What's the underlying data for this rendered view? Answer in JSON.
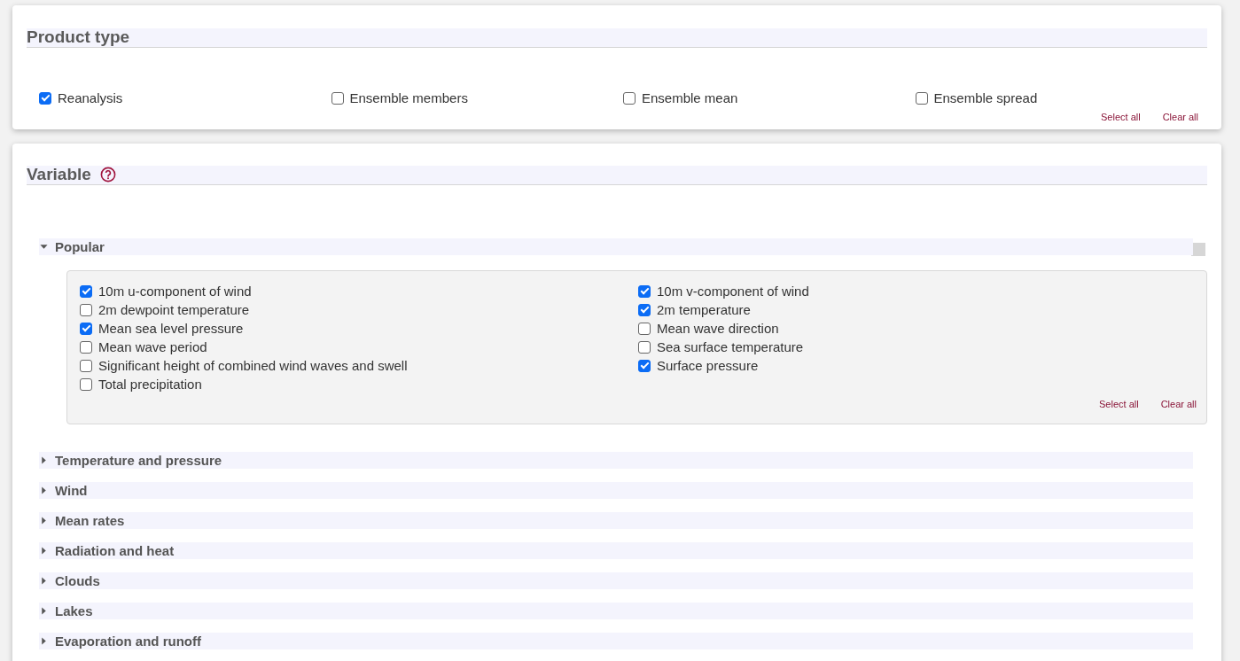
{
  "product_type": {
    "title": "Product type",
    "options": [
      {
        "label": "Reanalysis",
        "checked": true
      },
      {
        "label": "Ensemble members",
        "checked": false
      },
      {
        "label": "Ensemble mean",
        "checked": false
      },
      {
        "label": "Ensemble spread",
        "checked": false
      }
    ],
    "actions": [
      "Select all",
      "Clear all"
    ]
  },
  "variable": {
    "title": "Variable",
    "groups": [
      {
        "label": "Popular",
        "expanded": true,
        "items": [
          {
            "label": "10m u-component of wind",
            "checked": true
          },
          {
            "label": "10m v-component of wind",
            "checked": true
          },
          {
            "label": "2m dewpoint temperature",
            "checked": false
          },
          {
            "label": "2m temperature",
            "checked": true
          },
          {
            "label": "Mean sea level pressure",
            "checked": true
          },
          {
            "label": "Mean wave direction",
            "checked": false
          },
          {
            "label": "Mean wave period",
            "checked": false
          },
          {
            "label": "Sea surface temperature",
            "checked": false
          },
          {
            "label": "Significant height of combined wind waves and swell",
            "checked": false
          },
          {
            "label": "Surface pressure",
            "checked": true
          },
          {
            "label": "Total precipitation",
            "checked": false
          }
        ],
        "actions": [
          "Select all",
          "Clear all"
        ]
      },
      {
        "label": "Temperature and pressure",
        "expanded": false
      },
      {
        "label": "Wind",
        "expanded": false
      },
      {
        "label": "Mean rates",
        "expanded": false
      },
      {
        "label": "Radiation and heat",
        "expanded": false
      },
      {
        "label": "Clouds",
        "expanded": false
      },
      {
        "label": "Lakes",
        "expanded": false
      },
      {
        "label": "Evaporation and runoff",
        "expanded": false
      }
    ]
  }
}
